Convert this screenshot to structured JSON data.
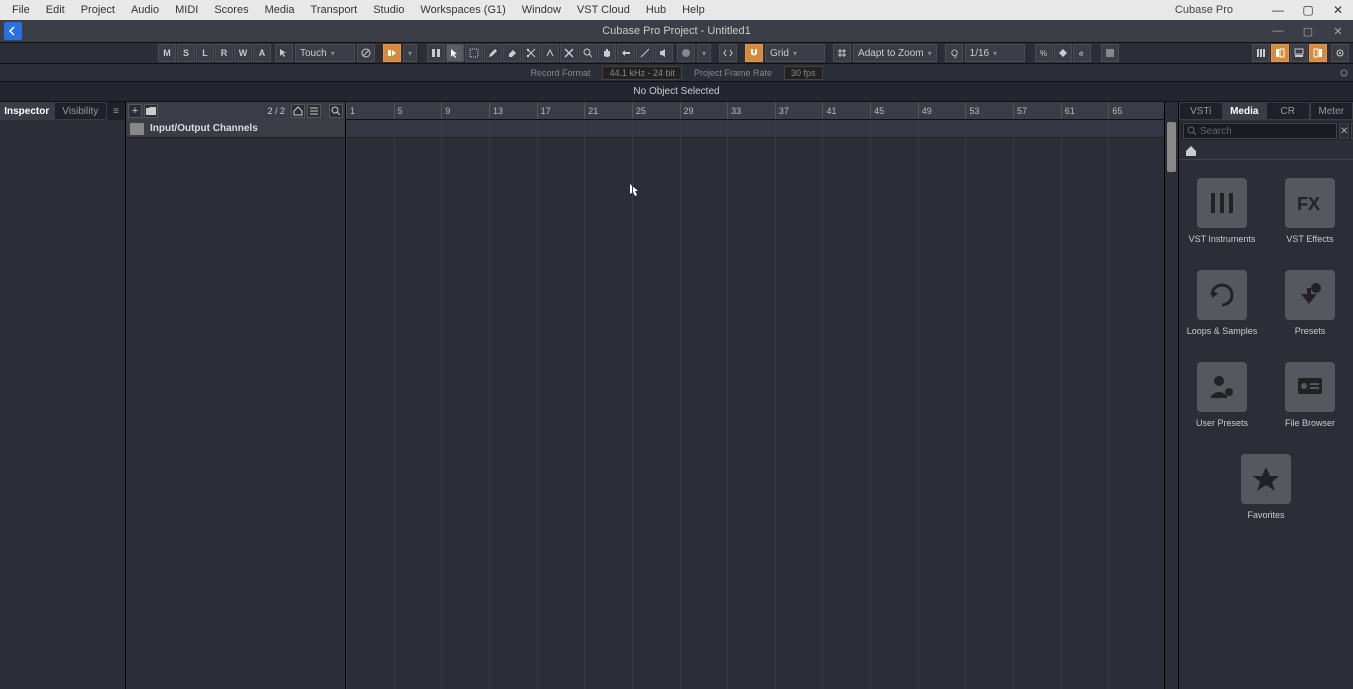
{
  "menu": [
    "File",
    "Edit",
    "Project",
    "Audio",
    "MIDI",
    "Scores",
    "Media",
    "Transport",
    "Studio",
    "Workspaces (G1)",
    "Window",
    "VST Cloud",
    "Hub",
    "Help"
  ],
  "app_title": "Cubase Pro",
  "project_title": "Cubase Pro Project - Untitled1",
  "toolbar": {
    "state_btns": [
      "M",
      "S",
      "L",
      "R",
      "W",
      "A"
    ],
    "automation_mode": "Touch",
    "snap_type": "Grid",
    "adapt": "Adapt to Zoom",
    "quantize": "1/16"
  },
  "status": {
    "record_format_label": "Record Format",
    "record_format_value": "44.1 kHz - 24 bit",
    "frame_rate_label": "Project Frame Rate",
    "frame_rate_value": "30 fps"
  },
  "info_line": "No Object Selected",
  "left_tabs": {
    "inspector": "Inspector",
    "visibility": "Visibility"
  },
  "track_header": {
    "count": "2 / 2"
  },
  "tracks": [
    {
      "name": "Input/Output Channels"
    }
  ],
  "ruler_ticks": [
    1,
    5,
    9,
    13,
    17,
    21,
    25,
    29,
    33,
    37,
    41,
    45,
    49,
    53,
    57,
    61,
    65
  ],
  "right_tabs": [
    "VSTi",
    "Media",
    "CR",
    "Meter"
  ],
  "right_active_tab": "Media",
  "search_placeholder": "Search",
  "media_tiles": [
    {
      "id": "vst-instruments",
      "label": "VST Instruments"
    },
    {
      "id": "vst-effects",
      "label": "VST Effects"
    },
    {
      "id": "loops-samples",
      "label": "Loops & Samples"
    },
    {
      "id": "presets",
      "label": "Presets"
    },
    {
      "id": "user-presets",
      "label": "User Presets"
    },
    {
      "id": "file-browser",
      "label": "File Browser"
    },
    {
      "id": "favorites",
      "label": "Favorites"
    }
  ]
}
